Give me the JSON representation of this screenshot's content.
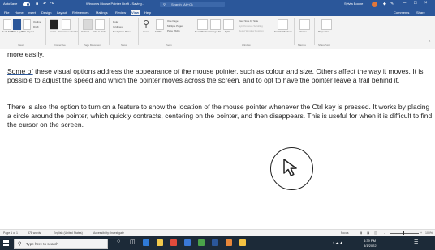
{
  "titlebar": {
    "autosave_label": "AutoSave",
    "doc_title": "Windows Mouse Pointer Draft - Saving...",
    "search_placeholder": "Search (Alt+Q)",
    "user_name": "Sylvia Boone"
  },
  "menu": {
    "tabs": [
      "File",
      "Home",
      "Insert",
      "Design",
      "Layout",
      "References",
      "Mailings",
      "Review",
      "View",
      "Help"
    ],
    "active_tab": "View",
    "comments_label": "Comments",
    "share_label": "Share"
  },
  "ribbon": {
    "groups": [
      "Views",
      "Immersive",
      "Page Movement",
      "Show",
      "Zoom",
      "Window",
      "Macros",
      "SharePoint"
    ],
    "buttons": {
      "read_mode": "Read Mode",
      "print_layout": "Print Layout",
      "web_layout": "Web Layout",
      "outline": "Outline",
      "draft": "Draft",
      "focus": "Focus",
      "immersive_reader": "Immersive Reader",
      "vertical": "Vertical",
      "side_to_side": "Side to Side",
      "ruler": "Ruler",
      "gridlines": "Gridlines",
      "navigation_pane": "Navigation Pane",
      "zoom": "Zoom",
      "hundred": "100%",
      "one_page": "One Page",
      "multiple_pages": "Multiple Pages",
      "page_width": "Page Width",
      "new_window": "New Window",
      "arrange_all": "Arrange All",
      "split": "Split",
      "view_side_by_side": "View Side by Side",
      "sync_scrolling": "Synchronous Scrolling",
      "reset_window": "Reset Window Position",
      "switch_windows": "Switch Windows",
      "macros": "Macros",
      "properties": "Properties"
    }
  },
  "document": {
    "line0": "more easily.",
    "p1_lead": "Some of",
    "p1_rest": " these visual options address the appearance of the mouse pointer, such as colour and size. Others affect the way it moves. It is possible to adjust the speed and which the pointer moves across the screen, and to opt to have the pointer leave a trail behind it.",
    "p2": "There is also the option to turn on a feature to show the location of the mouse pointer whenever the Ctrl key is pressed. It works by placing a circle around the pointer, which quickly contracts, centering on the pointer, and then disappears. This is useful for when it is difficult to find the cursor on the screen."
  },
  "statusbar": {
    "page": "Page 1 of 1",
    "words": "378 words",
    "language": "English (United States)",
    "accessibility": "Accessibility: Investigate",
    "focus": "Focus",
    "zoom": "100%"
  },
  "taskbar": {
    "search_placeholder": "Type here to search",
    "time": "4:39 PM",
    "date": "8/1/2022",
    "icon_colors": [
      "#2f7ad6",
      "#f2c94c",
      "#e04b3c",
      "#3a78d6",
      "#4aa34a",
      "#2b579a",
      "#e8873a",
      "#f5c242"
    ]
  },
  "colors": {
    "word_blue": "#2b579a",
    "ribbon_bg": "#f3f3f3",
    "taskbar_bg": "#1c2a38"
  }
}
